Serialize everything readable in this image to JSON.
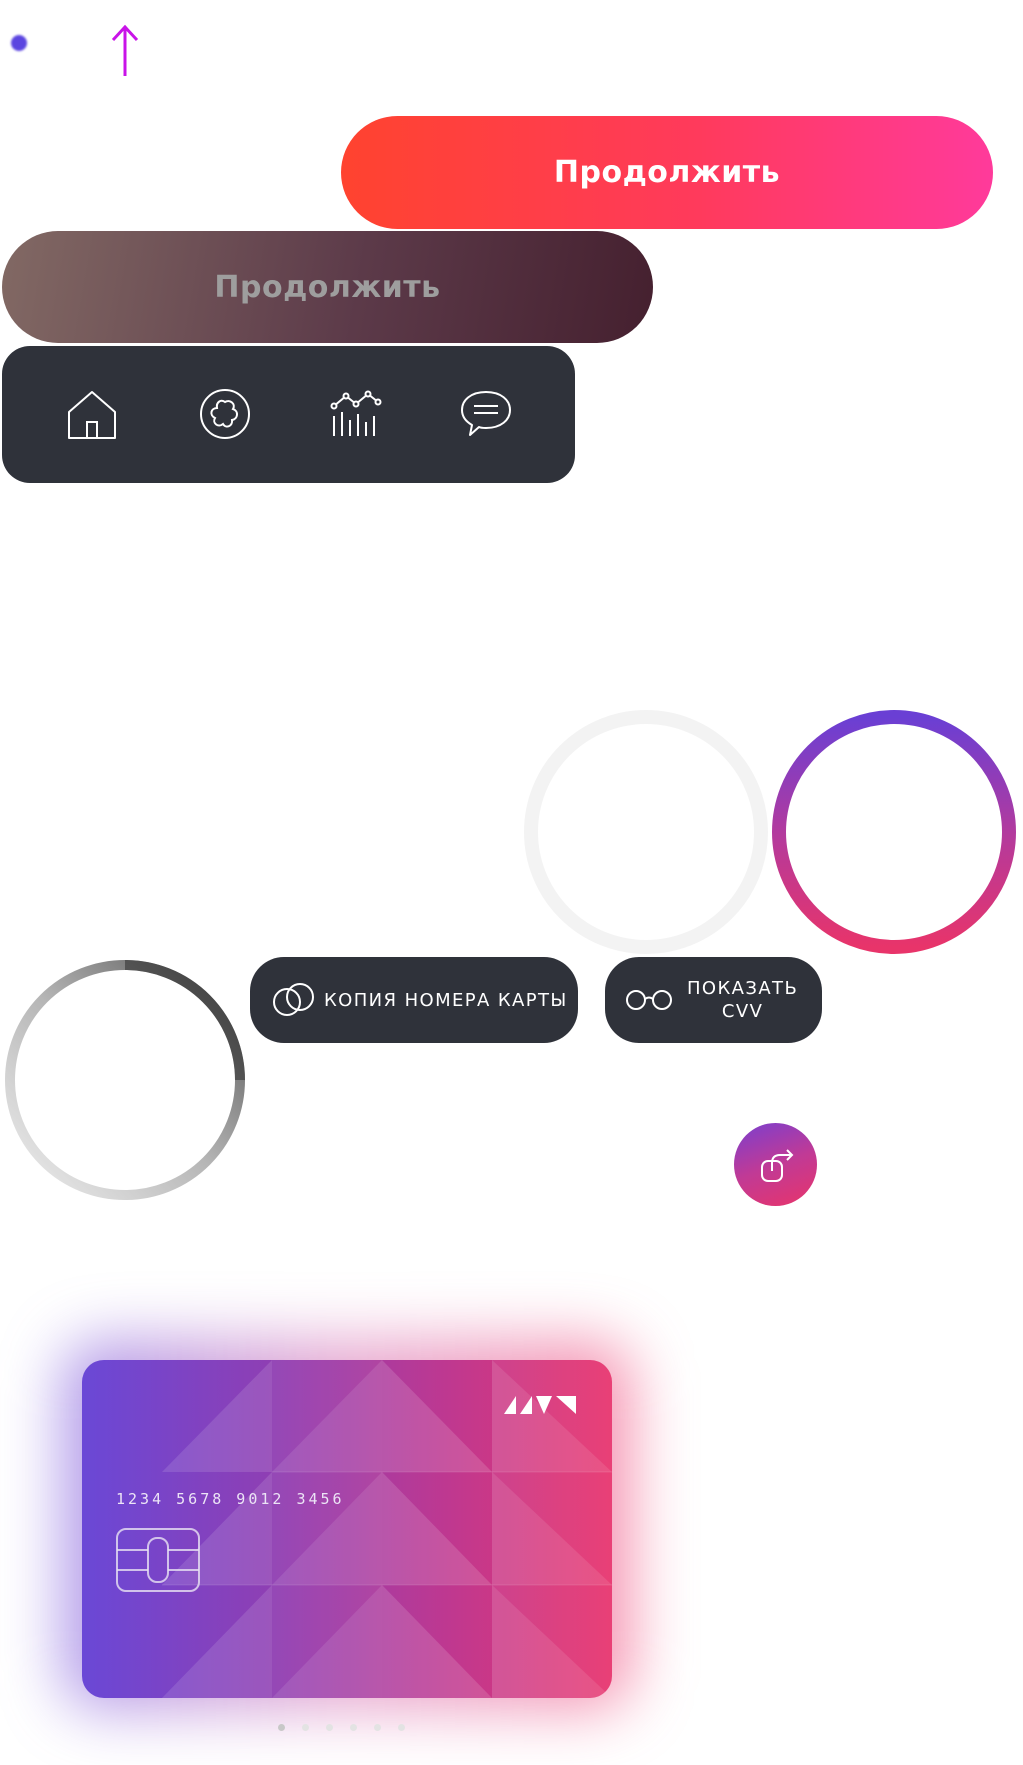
{
  "colors": {
    "accent_gradient": [
      "#ff432f",
      "#ff3a9b"
    ],
    "disabled_gradient": [
      "#826964",
      "#45202f"
    ],
    "dark_surface": "#2f323a",
    "ring_gradient": [
      "#6a3fd4",
      "#e8346a"
    ],
    "arrow": "#c913e8"
  },
  "top": {
    "icons": [
      "dot-indicator",
      "arrow-up-icon"
    ]
  },
  "buttons": {
    "primary_label": "Продолжить",
    "disabled_label": "Продолжить"
  },
  "tabbar": {
    "items": [
      {
        "icon": "home-icon"
      },
      {
        "icon": "flower-icon"
      },
      {
        "icon": "analytics-icon"
      },
      {
        "icon": "chat-icon"
      }
    ]
  },
  "actions": {
    "copy_label": "КОПИЯ НОМЕРА КАРТЫ",
    "copy_icon": "copy-circles-icon",
    "cvv_label_line1": "ПОКАЗАТЬ",
    "cvv_label_line2": "CVV",
    "cvv_icon": "glasses-icon",
    "share_icon": "share-icon"
  },
  "card": {
    "number": "1234 5678 9012 3456",
    "chip_icon": "chip-icon",
    "logo_icon": "bank-logo-icon"
  },
  "pager": {
    "count": 6,
    "active": 0
  }
}
